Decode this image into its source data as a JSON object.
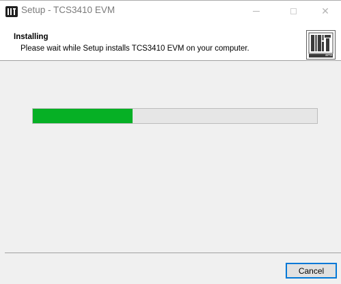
{
  "window": {
    "title": "Setup - TCS3410 EVM",
    "controls": {
      "minimize_icon": "minimize-icon",
      "maximize_icon": "maximize-icon",
      "close_glyph": "✕"
    }
  },
  "header": {
    "title": "Installing",
    "subtitle": "Please wait while Setup installs TCS3410 EVM on your computer.",
    "logo_caption": "ams"
  },
  "progress": {
    "value_fraction": 0.35,
    "fill_color": "#06b025",
    "track_color": "#e6e6e6"
  },
  "footer": {
    "cancel_label": "Cancel"
  },
  "colors": {
    "accent_focus": "#0078d7"
  }
}
